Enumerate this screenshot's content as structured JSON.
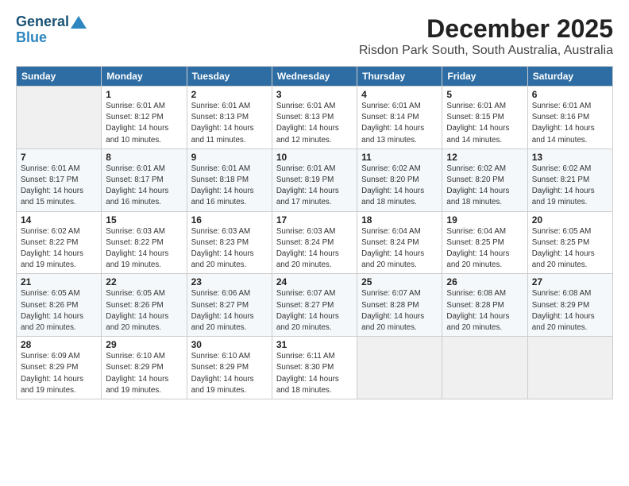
{
  "header": {
    "logo_line1": "General",
    "logo_line2": "Blue",
    "title": "December 2025",
    "subtitle": "Risdon Park South, South Australia, Australia"
  },
  "weekdays": [
    "Sunday",
    "Monday",
    "Tuesday",
    "Wednesday",
    "Thursday",
    "Friday",
    "Saturday"
  ],
  "weeks": [
    [
      {
        "day": "",
        "info": ""
      },
      {
        "day": "1",
        "info": "Sunrise: 6:01 AM\nSunset: 8:12 PM\nDaylight: 14 hours\nand 10 minutes."
      },
      {
        "day": "2",
        "info": "Sunrise: 6:01 AM\nSunset: 8:13 PM\nDaylight: 14 hours\nand 11 minutes."
      },
      {
        "day": "3",
        "info": "Sunrise: 6:01 AM\nSunset: 8:13 PM\nDaylight: 14 hours\nand 12 minutes."
      },
      {
        "day": "4",
        "info": "Sunrise: 6:01 AM\nSunset: 8:14 PM\nDaylight: 14 hours\nand 13 minutes."
      },
      {
        "day": "5",
        "info": "Sunrise: 6:01 AM\nSunset: 8:15 PM\nDaylight: 14 hours\nand 14 minutes."
      },
      {
        "day": "6",
        "info": "Sunrise: 6:01 AM\nSunset: 8:16 PM\nDaylight: 14 hours\nand 14 minutes."
      }
    ],
    [
      {
        "day": "7",
        "info": "Sunrise: 6:01 AM\nSunset: 8:17 PM\nDaylight: 14 hours\nand 15 minutes."
      },
      {
        "day": "8",
        "info": "Sunrise: 6:01 AM\nSunset: 8:17 PM\nDaylight: 14 hours\nand 16 minutes."
      },
      {
        "day": "9",
        "info": "Sunrise: 6:01 AM\nSunset: 8:18 PM\nDaylight: 14 hours\nand 16 minutes."
      },
      {
        "day": "10",
        "info": "Sunrise: 6:01 AM\nSunset: 8:19 PM\nDaylight: 14 hours\nand 17 minutes."
      },
      {
        "day": "11",
        "info": "Sunrise: 6:02 AM\nSunset: 8:20 PM\nDaylight: 14 hours\nand 18 minutes."
      },
      {
        "day": "12",
        "info": "Sunrise: 6:02 AM\nSunset: 8:20 PM\nDaylight: 14 hours\nand 18 minutes."
      },
      {
        "day": "13",
        "info": "Sunrise: 6:02 AM\nSunset: 8:21 PM\nDaylight: 14 hours\nand 19 minutes."
      }
    ],
    [
      {
        "day": "14",
        "info": "Sunrise: 6:02 AM\nSunset: 8:22 PM\nDaylight: 14 hours\nand 19 minutes."
      },
      {
        "day": "15",
        "info": "Sunrise: 6:03 AM\nSunset: 8:22 PM\nDaylight: 14 hours\nand 19 minutes."
      },
      {
        "day": "16",
        "info": "Sunrise: 6:03 AM\nSunset: 8:23 PM\nDaylight: 14 hours\nand 20 minutes."
      },
      {
        "day": "17",
        "info": "Sunrise: 6:03 AM\nSunset: 8:24 PM\nDaylight: 14 hours\nand 20 minutes."
      },
      {
        "day": "18",
        "info": "Sunrise: 6:04 AM\nSunset: 8:24 PM\nDaylight: 14 hours\nand 20 minutes."
      },
      {
        "day": "19",
        "info": "Sunrise: 6:04 AM\nSunset: 8:25 PM\nDaylight: 14 hours\nand 20 minutes."
      },
      {
        "day": "20",
        "info": "Sunrise: 6:05 AM\nSunset: 8:25 PM\nDaylight: 14 hours\nand 20 minutes."
      }
    ],
    [
      {
        "day": "21",
        "info": "Sunrise: 6:05 AM\nSunset: 8:26 PM\nDaylight: 14 hours\nand 20 minutes."
      },
      {
        "day": "22",
        "info": "Sunrise: 6:05 AM\nSunset: 8:26 PM\nDaylight: 14 hours\nand 20 minutes."
      },
      {
        "day": "23",
        "info": "Sunrise: 6:06 AM\nSunset: 8:27 PM\nDaylight: 14 hours\nand 20 minutes."
      },
      {
        "day": "24",
        "info": "Sunrise: 6:07 AM\nSunset: 8:27 PM\nDaylight: 14 hours\nand 20 minutes."
      },
      {
        "day": "25",
        "info": "Sunrise: 6:07 AM\nSunset: 8:28 PM\nDaylight: 14 hours\nand 20 minutes."
      },
      {
        "day": "26",
        "info": "Sunrise: 6:08 AM\nSunset: 8:28 PM\nDaylight: 14 hours\nand 20 minutes."
      },
      {
        "day": "27",
        "info": "Sunrise: 6:08 AM\nSunset: 8:29 PM\nDaylight: 14 hours\nand 20 minutes."
      }
    ],
    [
      {
        "day": "28",
        "info": "Sunrise: 6:09 AM\nSunset: 8:29 PM\nDaylight: 14 hours\nand 19 minutes."
      },
      {
        "day": "29",
        "info": "Sunrise: 6:10 AM\nSunset: 8:29 PM\nDaylight: 14 hours\nand 19 minutes."
      },
      {
        "day": "30",
        "info": "Sunrise: 6:10 AM\nSunset: 8:29 PM\nDaylight: 14 hours\nand 19 minutes."
      },
      {
        "day": "31",
        "info": "Sunrise: 6:11 AM\nSunset: 8:30 PM\nDaylight: 14 hours\nand 18 minutes."
      },
      {
        "day": "",
        "info": ""
      },
      {
        "day": "",
        "info": ""
      },
      {
        "day": "",
        "info": ""
      }
    ]
  ]
}
